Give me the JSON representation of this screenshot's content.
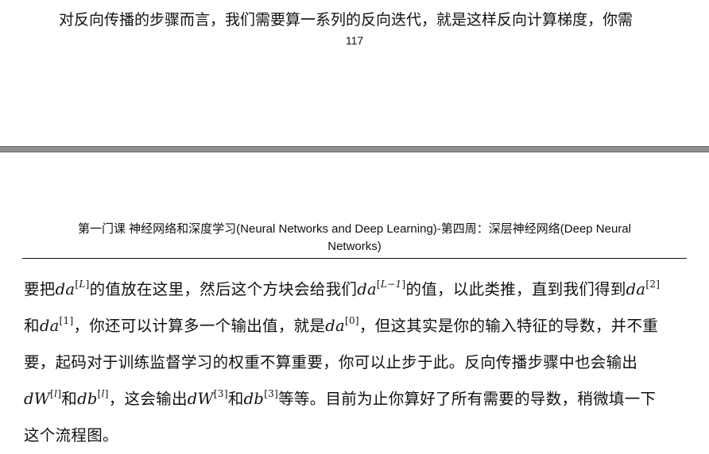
{
  "previous_page": {
    "last_line": "对反向传播的步骤而言，我们需要算一系列的反向迭代，就是这样反向计算梯度，你需",
    "page_number": "117"
  },
  "header": {
    "line1": "第一门课  神经网络和深度学习(Neural Networks and Deep Learning)-第四周：深层神经网络(Deep Neural",
    "line2": "Networks)"
  },
  "body": {
    "l1_a": "要把",
    "da": "da",
    "dW": "dW",
    "db": "db",
    "sup_L": "L",
    "sup_Lm1": "L−1",
    "sup_2": "2",
    "sup_1": "1",
    "sup_0": "0",
    "sup_l": "l",
    "sup_3": "3",
    "l1_b": "的值放在这里，然后这个方块会给我们",
    "l1_c": "的值，以此类推，直到我们得到",
    "l2_a": "和",
    "l2_b": "，你还可以计算多一个输出值，就是",
    "l2_c": "，但这其实是你的输入特征的导数，并不重",
    "l3": "要，起码对于训练监督学习的权重不算重要，你可以止步于此。反向传播步骤中也会输出",
    "l4_and": "和",
    "l4_b": "，这会输出",
    "l4_c": "等等。目前为止你算好了所有需要的导数，稍微填一下",
    "l5": "这个流程图。"
  }
}
